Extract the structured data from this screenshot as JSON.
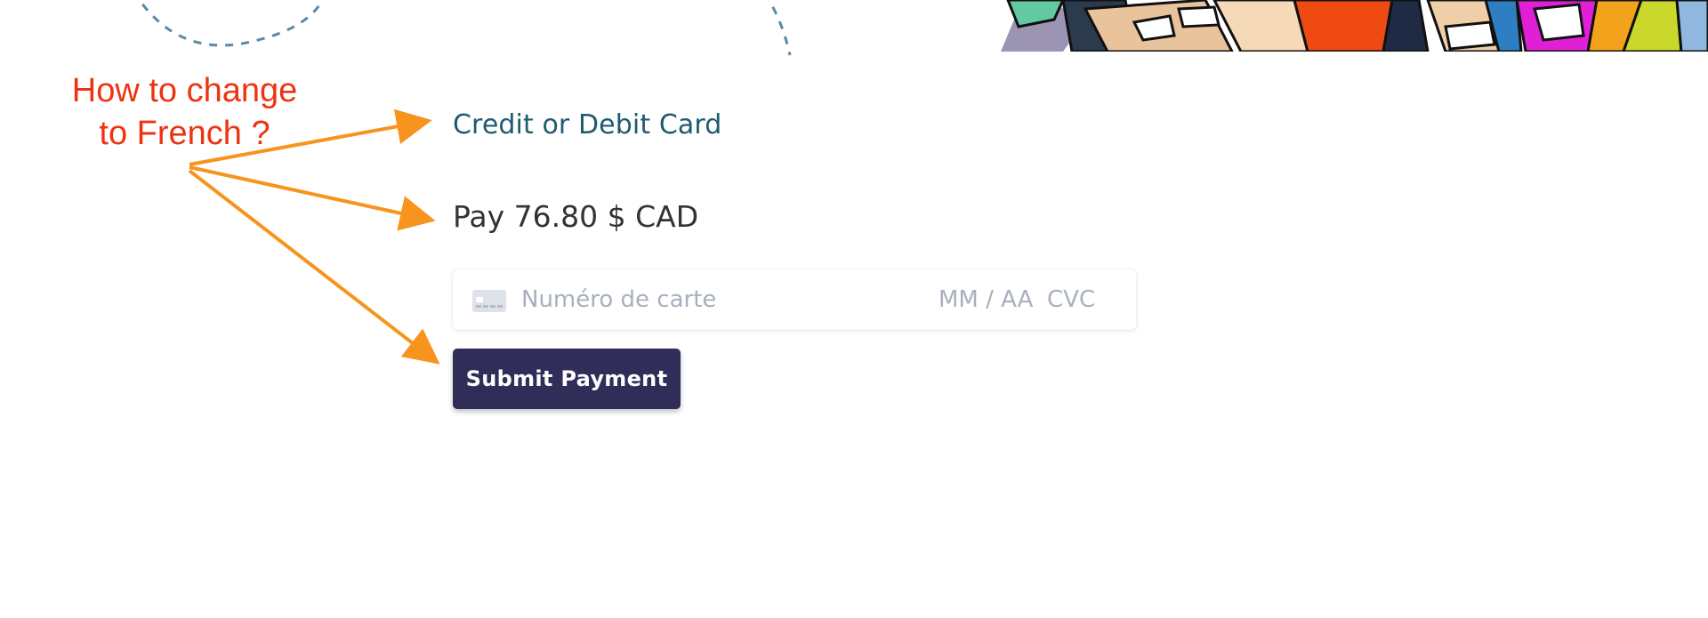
{
  "annotation": {
    "line1": "How to change",
    "line2": "to French ?",
    "color": "#ee3311",
    "arrow_color": "#f7941d"
  },
  "payment": {
    "method_label": "Credit or Debit Card",
    "pay_label": "Pay 76.80 $ CAD",
    "card_number_placeholder": "Numéro de carte",
    "expiry_placeholder": "MM / AA",
    "cvc_placeholder": "CVC",
    "submit_label": "Submit Payment",
    "icons": {
      "card": "credit-card-icon"
    }
  },
  "colors": {
    "method_label": "#1f5a70",
    "button_bg": "#302d59",
    "placeholder": "#a7b0bd"
  }
}
